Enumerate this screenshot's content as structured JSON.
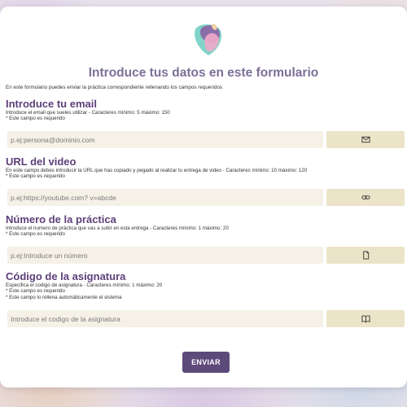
{
  "form": {
    "title": "Introduce tus datos en este formulario",
    "intro": "En este formulario puedes enviar la práctica correspondiente rellenando los campos requeridos",
    "submit_label": "ENVIAR"
  },
  "fields": [
    {
      "title": "Introduce tu email",
      "desc": "Introduce el email que sueles utilizar - Caracteres mínimo: 5 máximo: 150",
      "notes": [
        "* Este campo es requerido"
      ],
      "placeholder": "p.ej:persona@dominio.com",
      "icon": "envelope-icon"
    },
    {
      "title": "URL del video",
      "desc": "En este campo debes introducir la URL que has copiado y pegado al realizar tu entrega de video - Caracteres mínimo: 10 máximo: 120",
      "notes": [
        "* Este campo es requerido"
      ],
      "placeholder": "p.ej:https://youtube.com? v=abcde",
      "icon": "link-icon"
    },
    {
      "title": "Número de la práctica",
      "desc": "Introduce el numero de práctica que vas a subir en esta entrega - Caracteres mínimo: 1 máximo: 20",
      "notes": [
        "* Este campo es requerido"
      ],
      "placeholder": "p.ej:Introduce un número",
      "icon": "document-icon"
    },
    {
      "title": "Código de la asignatura",
      "desc": "Especifica el codigo de asignatura - Caracteres mínimo: 1 máximo: 20",
      "notes": [
        "* Este campo es requerido",
        "* Este campo lo rellena automáticamente el sistema"
      ],
      "placeholder": "Introduce el codigo de la asignatura",
      "icon": "book-icon"
    }
  ],
  "colors": {
    "accent": "#5e4a7a",
    "title": "#5d3f7a",
    "field_bg": "#f5f1e7",
    "icon_button_bg": "#ece4c8"
  }
}
